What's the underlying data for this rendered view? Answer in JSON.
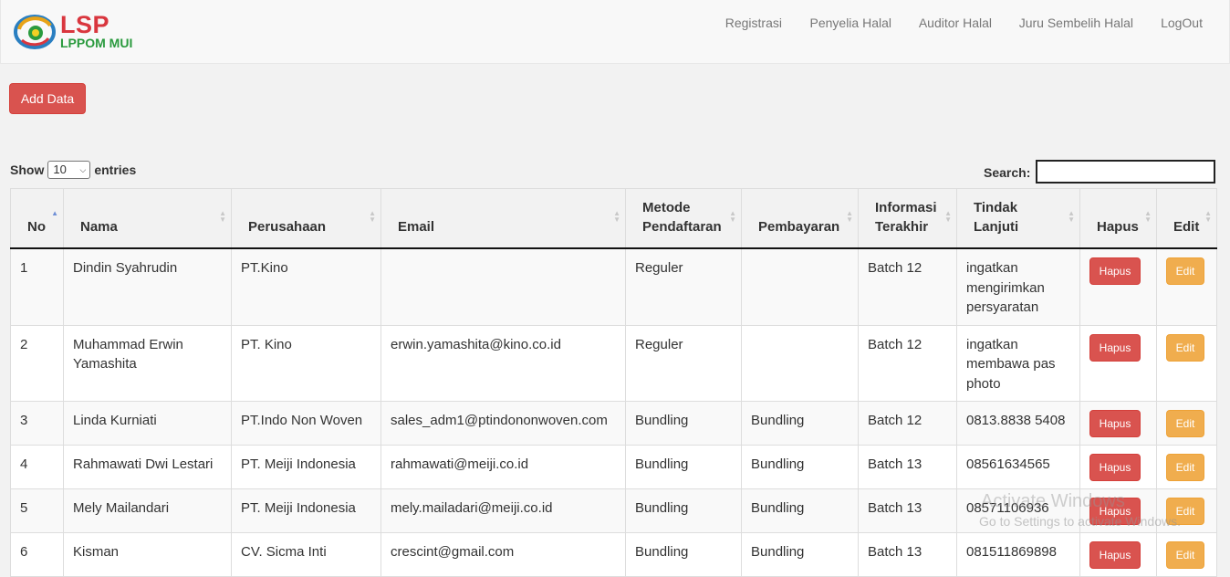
{
  "brand": {
    "name": "LSP",
    "subtitle": "LPPOM MUI"
  },
  "nav": {
    "items": [
      "Registrasi",
      "Penyelia Halal",
      "Auditor Halal",
      "Juru Sembelih Halal",
      "LogOut"
    ]
  },
  "toolbar": {
    "add_label": "Add Data"
  },
  "length": {
    "show_label": "Show",
    "value": "10",
    "entries_label": "entries"
  },
  "search": {
    "label": "Search:",
    "value": ""
  },
  "table": {
    "headers": {
      "no": "No",
      "nama": "Nama",
      "perusahaan": "Perusahaan",
      "email": "Email",
      "metode": "Metode Pendaftaran",
      "pembayaran": "Pembayaran",
      "informasi": "Informasi Terakhir",
      "tindak": "Tindak Lanjuti",
      "hapus": "Hapus",
      "edit": "Edit"
    },
    "hapus_label": "Hapus",
    "edit_label": "Edit",
    "rows": [
      {
        "no": "1",
        "nama": "Dindin Syahrudin",
        "perusahaan": "PT.Kino",
        "email": "",
        "metode": "Reguler",
        "pembayaran": "",
        "informasi": "Batch 12",
        "tindak": "ingatkan mengirimkan persyaratan"
      },
      {
        "no": "2",
        "nama": "Muhammad Erwin Yamashita",
        "perusahaan": "PT. Kino",
        "email": "erwin.yamashita@kino.co.id",
        "metode": "Reguler",
        "pembayaran": "",
        "informasi": "Batch 12",
        "tindak": "ingatkan membawa pas photo"
      },
      {
        "no": "3",
        "nama": "Linda Kurniati",
        "perusahaan": "PT.Indo Non Woven",
        "email": "sales_adm1@ptindononwoven.com",
        "metode": "Bundling",
        "pembayaran": "Bundling",
        "informasi": "Batch 12",
        "tindak": "0813.8838 5408"
      },
      {
        "no": "4",
        "nama": "Rahmawati Dwi Lestari",
        "perusahaan": "PT. Meiji Indonesia",
        "email": "rahmawati@meiji.co.id",
        "metode": "Bundling",
        "pembayaran": "Bundling",
        "informasi": "Batch 13",
        "tindak": "08561634565"
      },
      {
        "no": "5",
        "nama": "Mely Mailandari",
        "perusahaan": "PT. Meiji Indonesia",
        "email": "mely.mailadari@meiji.co.id",
        "metode": "Bundling",
        "pembayaran": "Bundling",
        "informasi": "Batch 13",
        "tindak": "08571106936"
      },
      {
        "no": "6",
        "nama": "Kisman",
        "perusahaan": "CV. Sicma Inti",
        "email": "crescint@gmail.com",
        "metode": "Bundling",
        "pembayaran": "Bundling",
        "informasi": "Batch 13",
        "tindak": "081511869898"
      }
    ]
  },
  "watermark": {
    "line1": "Activate Windows",
    "line2": "Go to Settings to activate Windows."
  }
}
